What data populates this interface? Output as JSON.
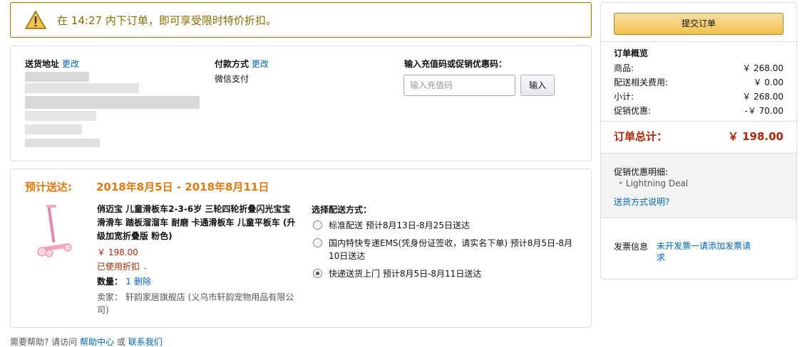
{
  "alert": {
    "prefix": "在",
    "time": "14:27",
    "suffix": "内下订单，即可享受限时特价折扣。",
    "icon": "warning-icon"
  },
  "address": {
    "label": "送货地址",
    "change_link": "更改"
  },
  "payment": {
    "label": "付款方式",
    "change_link": "更改",
    "value": "微信支付"
  },
  "promo_code": {
    "label": "输入充值码或促销优惠码：",
    "placeholder": "输入充值码",
    "button": "输入"
  },
  "delivery": {
    "title": "预计送达:",
    "date_range": "2018年8月5日 - 2018年8月11日"
  },
  "product": {
    "title": "俏迈宝 儿童滑板车2-3-6岁 三轮四轮折叠闪光宝宝滑滑车 踏板溜溜车 耐磨 卡通滑板车 儿童平板车 (升级加宽折叠版 粉色)",
    "price": "￥ 198.00",
    "promo_used": "已使用折扣",
    "quantity_label": "数量：",
    "quantity": "1",
    "delete_link": "删除",
    "seller_label": "卖家：",
    "seller_name": "轩韵家居旗舰店 (义乌市轩韵宠物用品有限公司)"
  },
  "shipping": {
    "header": "选择配送方式：",
    "options": [
      {
        "label": "标准配送  预计8月13日-8月25日送达",
        "selected": false
      },
      {
        "label": "国内特快专递EMS(凭身份证签收，请实名下单) 预计8月5日-8月10日送达",
        "selected": false
      },
      {
        "label": "快递送货上门  预计8月5日-8月11日送达",
        "selected": true
      }
    ]
  },
  "help": {
    "prefix": "需要帮助? 请访问",
    "help_center": "帮助中心",
    "or": "或",
    "contact": "联系我们"
  },
  "summary": {
    "submit_button": "提交订单",
    "title": "订单概览",
    "rows": [
      {
        "label": "商品:",
        "value": "￥ 268.00"
      },
      {
        "label": "配送相关费用:",
        "value": "￥ 0.00"
      },
      {
        "label": "小计:",
        "value": "￥ 268.00"
      },
      {
        "label": "促销优惠:",
        "value": "-￥ 70.00"
      }
    ],
    "total_label": "订单总计：",
    "total_value": "￥ 198.00",
    "promo_detail_label": "促销优惠明细:",
    "promo_item": "Lightning Deal",
    "shipping_explain": "送货方式说明?",
    "invoice_label": "发票信息",
    "invoice_value": "未开发票一请添加发票请求"
  },
  "colors": {
    "accent_orange": "#e47911",
    "price_red": "#b12704",
    "link_blue": "#0066c0",
    "alert_text": "#8a6c00",
    "submit_button": "#f0c14b"
  }
}
